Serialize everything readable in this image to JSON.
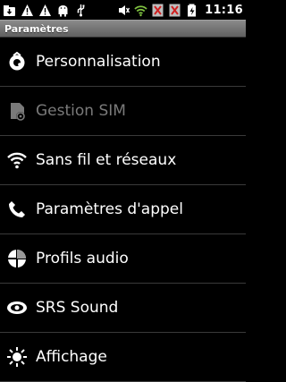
{
  "status_bar": {
    "time": "11:16",
    "icons": [
      "download-icon",
      "warning-icon",
      "warning-icon",
      "android-debug-icon",
      "usb-icon",
      "mute-icon",
      "wifi-icon",
      "no-signal-icon",
      "no-signal-icon",
      "battery-charging-icon"
    ]
  },
  "header": {
    "title": "Paramètres"
  },
  "menu": {
    "items": [
      {
        "label": "Personnalisation",
        "icon": "personalization-icon",
        "enabled": true
      },
      {
        "label": "Gestion SIM",
        "icon": "sim-icon",
        "enabled": false
      },
      {
        "label": "Sans fil et réseaux",
        "icon": "wifi-icon",
        "enabled": true
      },
      {
        "label": "Paramètres d'appel",
        "icon": "phone-icon",
        "enabled": true
      },
      {
        "label": "Profils audio",
        "icon": "audio-profile-icon",
        "enabled": true
      },
      {
        "label": "SRS Sound",
        "icon": "srs-icon",
        "enabled": true
      },
      {
        "label": "Affichage",
        "icon": "display-icon",
        "enabled": true
      }
    ]
  },
  "colors": {
    "background": "#000000",
    "text": "#ffffff",
    "disabled_text": "#7a7a7a",
    "divider": "#3a3a3a",
    "wifi_green": "#7fc241",
    "alert_red": "#d02020"
  }
}
